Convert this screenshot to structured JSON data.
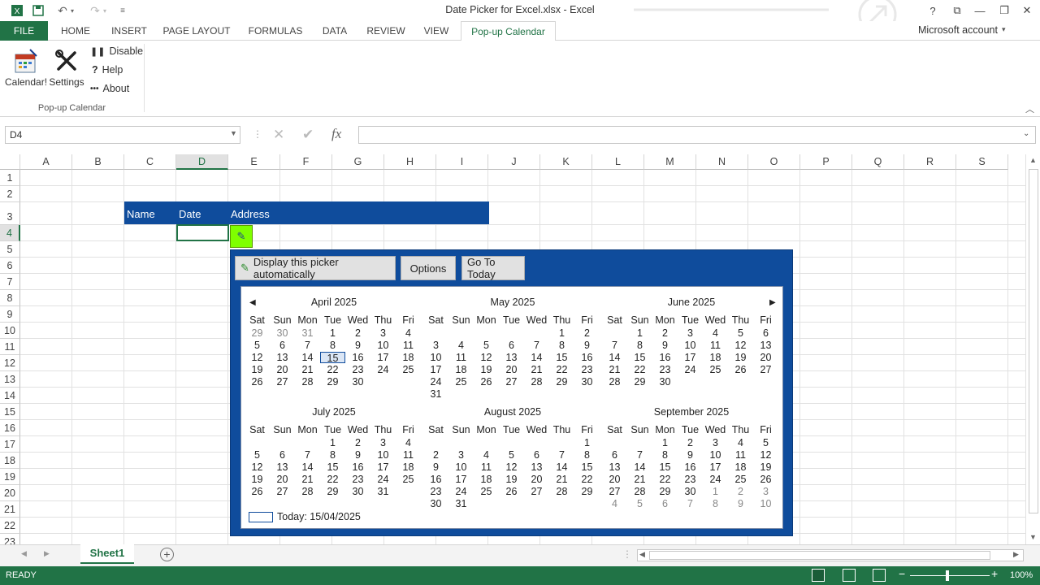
{
  "window": {
    "title": "Date Picker for Excel.xlsx - Excel"
  },
  "tabs": [
    {
      "label": "FILE"
    },
    {
      "label": "HOME"
    },
    {
      "label": "INSERT"
    },
    {
      "label": "PAGE LAYOUT"
    },
    {
      "label": "FORMULAS"
    },
    {
      "label": "DATA"
    },
    {
      "label": "REVIEW"
    },
    {
      "label": "VIEW"
    },
    {
      "label": "Pop-up Calendar"
    }
  ],
  "account": "Microsoft account",
  "ribbon": {
    "calendar": "Calendar!",
    "settings": "Settings",
    "disable": "Disable",
    "help": "Help",
    "about": "About",
    "group": "Pop-up Calendar"
  },
  "namebox": "D4",
  "columns": [
    "A",
    "B",
    "C",
    "D",
    "E",
    "F",
    "G",
    "H",
    "I",
    "J",
    "K",
    "L",
    "M",
    "N",
    "O",
    "P",
    "Q",
    "R",
    "S"
  ],
  "rows": [
    "1",
    "2",
    "3",
    "4",
    "5",
    "6",
    "7",
    "8",
    "9",
    "10",
    "11",
    "12",
    "13",
    "14",
    "15",
    "16",
    "17",
    "18",
    "19",
    "20",
    "21",
    "22",
    "23"
  ],
  "table_header": {
    "name": "Name",
    "date": "Date",
    "address": "Address"
  },
  "picker": {
    "auto_label": "Display this picker automatically",
    "options_label": "Options",
    "today_btn": "Go To Today",
    "weekdays": [
      "Sat",
      "Sun",
      "Mon",
      "Tue",
      "Wed",
      "Thu",
      "Fri"
    ],
    "today_text": "Today: 15/04/2025",
    "months": [
      {
        "title": "April 2025",
        "weeks": [
          [
            "29",
            "30",
            "31",
            "1",
            "2",
            "3",
            "4"
          ],
          [
            "5",
            "6",
            "7",
            "8",
            "9",
            "10",
            "11"
          ],
          [
            "12",
            "13",
            "14",
            "15",
            "16",
            "17",
            "18"
          ],
          [
            "19",
            "20",
            "21",
            "22",
            "23",
            "24",
            "25"
          ],
          [
            "26",
            "27",
            "28",
            "29",
            "30",
            "",
            ""
          ]
        ],
        "other": [
          [
            0,
            0
          ],
          [
            0,
            1
          ],
          [
            0,
            2
          ]
        ],
        "today": [
          2,
          3
        ]
      },
      {
        "title": "May 2025",
        "weeks": [
          [
            "",
            "",
            "",
            "",
            "",
            "1",
            "2"
          ],
          [
            "3",
            "4",
            "5",
            "6",
            "7",
            "8",
            "9"
          ],
          [
            "10",
            "11",
            "12",
            "13",
            "14",
            "15",
            "16"
          ],
          [
            "17",
            "18",
            "19",
            "20",
            "21",
            "22",
            "23"
          ],
          [
            "24",
            "25",
            "26",
            "27",
            "28",
            "29",
            "30"
          ],
          [
            "31",
            "",
            "",
            "",
            "",
            "",
            ""
          ]
        ]
      },
      {
        "title": "June 2025",
        "weeks": [
          [
            "",
            "1",
            "2",
            "3",
            "4",
            "5",
            "6"
          ],
          [
            "7",
            "8",
            "9",
            "10",
            "11",
            "12",
            "13"
          ],
          [
            "14",
            "15",
            "16",
            "17",
            "18",
            "19",
            "20"
          ],
          [
            "21",
            "22",
            "23",
            "24",
            "25",
            "26",
            "27"
          ],
          [
            "28",
            "29",
            "30",
            "",
            "",
            "",
            ""
          ]
        ]
      },
      {
        "title": "July 2025",
        "weeks": [
          [
            "",
            "",
            "",
            "1",
            "2",
            "3",
            "4"
          ],
          [
            "5",
            "6",
            "7",
            "8",
            "9",
            "10",
            "11"
          ],
          [
            "12",
            "13",
            "14",
            "15",
            "16",
            "17",
            "18"
          ],
          [
            "19",
            "20",
            "21",
            "22",
            "23",
            "24",
            "25"
          ],
          [
            "26",
            "27",
            "28",
            "29",
            "30",
            "31",
            ""
          ]
        ]
      },
      {
        "title": "August 2025",
        "weeks": [
          [
            "",
            "",
            "",
            "",
            "",
            "",
            "1"
          ],
          [
            "2",
            "3",
            "4",
            "5",
            "6",
            "7",
            "8"
          ],
          [
            "9",
            "10",
            "11",
            "12",
            "13",
            "14",
            "15"
          ],
          [
            "16",
            "17",
            "18",
            "19",
            "20",
            "21",
            "22"
          ],
          [
            "23",
            "24",
            "25",
            "26",
            "27",
            "28",
            "29"
          ],
          [
            "30",
            "31",
            "",
            "",
            "",
            "",
            ""
          ]
        ]
      },
      {
        "title": "September 2025",
        "weeks": [
          [
            "",
            "",
            "1",
            "2",
            "3",
            "4",
            "5"
          ],
          [
            "6",
            "7",
            "8",
            "9",
            "10",
            "11",
            "12"
          ],
          [
            "13",
            "14",
            "15",
            "16",
            "17",
            "18",
            "19"
          ],
          [
            "20",
            "21",
            "22",
            "23",
            "24",
            "25",
            "26"
          ],
          [
            "27",
            "28",
            "29",
            "30",
            "1",
            "2",
            "3"
          ],
          [
            "4",
            "5",
            "6",
            "7",
            "8",
            "9",
            "10"
          ]
        ],
        "other": [
          [
            4,
            4
          ],
          [
            4,
            5
          ],
          [
            4,
            6
          ],
          [
            5,
            0
          ],
          [
            5,
            1
          ],
          [
            5,
            2
          ],
          [
            5,
            3
          ],
          [
            5,
            4
          ],
          [
            5,
            5
          ],
          [
            5,
            6
          ]
        ]
      }
    ]
  },
  "sheet": {
    "tab": "Sheet1"
  },
  "status": {
    "ready": "READY",
    "zoom": "100%"
  }
}
